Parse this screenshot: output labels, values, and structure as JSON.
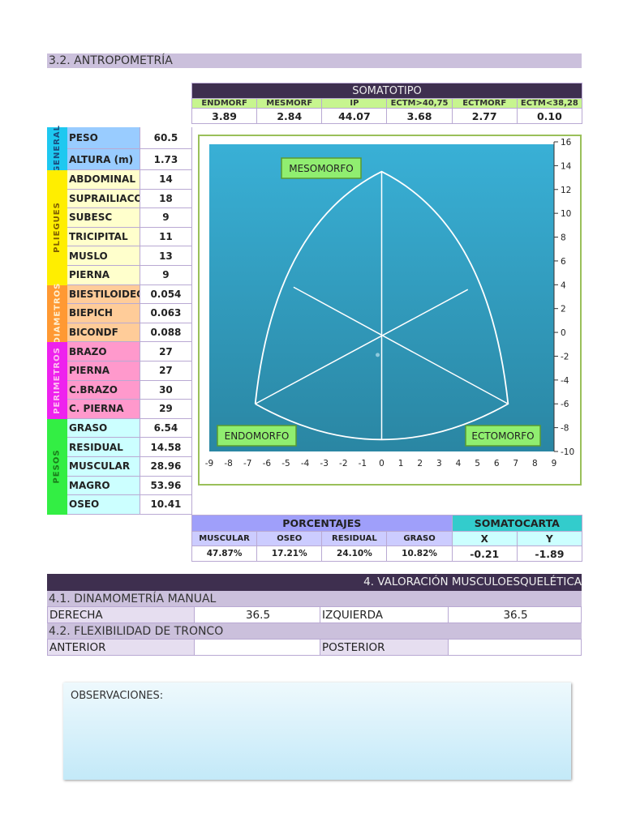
{
  "section_title": "3.2. ANTROPOMETRÍA",
  "somatotipo": {
    "title": "SOMATOTIPO",
    "headers": [
      "ENDMORF",
      "MESMORF",
      "IP",
      "ECTM>40,75",
      "ECTMORF",
      "ECTM<38,28"
    ],
    "values": [
      "3.89",
      "2.84",
      "44.07",
      "3.68",
      "2.77",
      "0.10"
    ]
  },
  "groups": [
    {
      "name": "GENERAL",
      "color": "#1ec8f0",
      "cell": "#99ccff",
      "text": "#1a4d80",
      "rows": [
        [
          "PESO",
          "60.5"
        ],
        [
          "ALTURA (m)",
          "1.73"
        ]
      ]
    },
    {
      "name": "PLIEGUES",
      "color": "#ffee00",
      "cell": "#ffffcc",
      "text": "#806000",
      "rows": [
        [
          "ABDOMINAL",
          "14"
        ],
        [
          "SUPRAILIACO",
          "18"
        ],
        [
          "SUBESC",
          "9"
        ],
        [
          "TRICIPITAL",
          "11"
        ],
        [
          "MUSLO",
          "13"
        ],
        [
          "PIERNA",
          "9"
        ]
      ]
    },
    {
      "name": "DIAMETROS",
      "color": "#ff9933",
      "cell": "#ffcc99",
      "text": "#fff0d0",
      "rows": [
        [
          "BIESTILOIDEO",
          "0.054"
        ],
        [
          "BIEPICH",
          "0.063"
        ],
        [
          "BICONDF",
          "0.088"
        ]
      ]
    },
    {
      "name": "PERIMETROS",
      "color": "#ee22ee",
      "cell": "#ff99cc",
      "text": "#ffc0f0",
      "rows": [
        [
          "BRAZO",
          "27"
        ],
        [
          "PIERNA",
          "27"
        ],
        [
          "C.BRAZO",
          "30"
        ],
        [
          "C. PIERNA",
          "29"
        ]
      ]
    },
    {
      "name": "PESOS",
      "color": "#33ee44",
      "cell": "#ccffff",
      "text": "#1a7a1a",
      "rows": [
        [
          "GRASO",
          "6.54"
        ],
        [
          "RESIDUAL",
          "14.58"
        ],
        [
          "MUSCULAR",
          "28.96"
        ],
        [
          "MAGRO",
          "53.96"
        ],
        [
          "OSEO",
          "10.41"
        ]
      ]
    }
  ],
  "chart_data": {
    "type": "scatter",
    "title": "Somatocarta",
    "xlim": [
      -9,
      9
    ],
    "ylim": [
      -10,
      16
    ],
    "xticks": [
      -9,
      -8,
      -7,
      -6,
      -5,
      -4,
      -3,
      -2,
      -1,
      0,
      1,
      2,
      3,
      4,
      5,
      6,
      7,
      8,
      9
    ],
    "yticks": [
      16,
      14,
      12,
      10,
      8,
      6,
      4,
      2,
      0,
      -2,
      -4,
      -6,
      -8,
      -10
    ],
    "labels": {
      "meso": "MESOMORFO",
      "endo": "ENDOMORFO",
      "ecto": "ECTOMORFO"
    },
    "point": {
      "x": -0.21,
      "y": -1.89
    },
    "colors": {
      "bg_top": "#39b0d6",
      "bg_bottom": "#2a86a3",
      "label_bg": "#90ee70"
    }
  },
  "porcentajes": {
    "title": "PORCENTAJES",
    "headers": [
      "MUSCULAR",
      "OSEO",
      "RESIDUAL",
      "GRASO"
    ],
    "values": [
      "47.87%",
      "17.21%",
      "24.10%",
      "10.82%"
    ]
  },
  "somatocarta": {
    "title": "SOMATOCARTA",
    "headers": [
      "X",
      "Y"
    ],
    "values": [
      "-0.21",
      "-1.89"
    ]
  },
  "musculo": {
    "title": "4. VALORACIÓN MUSCULOESQUELÉTICA",
    "dinamo": "4.1. DINAMOMETRÍA MANUAL",
    "derecha": "DERECHA",
    "derecha_val": "36.5",
    "izquierda": "IZQUIERDA",
    "izquierda_val": "36.5",
    "flex": "4.2. FLEXIBILIDAD DE TRONCO",
    "anterior": "ANTERIOR",
    "anterior_val": "",
    "posterior": "POSTERIOR",
    "posterior_val": ""
  },
  "observaciones": "OBSERVACIONES:"
}
